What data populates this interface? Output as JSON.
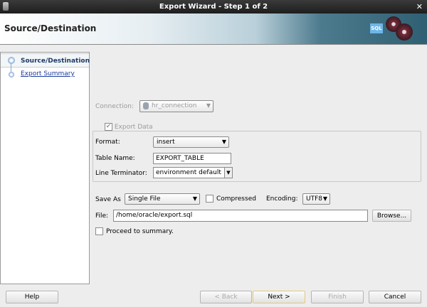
{
  "window": {
    "title": "Export Wizard - Step 1 of 2",
    "close_icon": "close-icon",
    "app_icon": "database-app-icon"
  },
  "header": {
    "title": "Source/Destination",
    "logo_icon": "sql-export-reels-icon"
  },
  "steps": [
    {
      "label": "Source/Destination",
      "selected": true
    },
    {
      "label": "Export Summary",
      "selected": false
    }
  ],
  "form": {
    "connection": {
      "label": "Connection:",
      "value": "hr_connection",
      "icon": "database-icon",
      "enabled": false
    },
    "export_data": {
      "label": "Export Data",
      "checked": true,
      "enabled": false
    },
    "format": {
      "label": "Format:",
      "value": "insert"
    },
    "table_name": {
      "label": "Table Name:",
      "value": "EXPORT_TABLE"
    },
    "line_terminator": {
      "label": "Line Terminator:",
      "value": "environment default"
    },
    "save_as": {
      "label": "Save As",
      "value": "Single File"
    },
    "compressed": {
      "label": "Compressed",
      "checked": false
    },
    "encoding": {
      "label": "Encoding:",
      "value": "UTF8"
    },
    "file": {
      "label": "File:",
      "value": "/home/oracle/export.sql"
    },
    "browse": "Browse...",
    "proceed": {
      "label": "Proceed to summary.",
      "checked": false
    }
  },
  "buttons": {
    "help": "Help",
    "back": "< Back",
    "next": "Next >",
    "finish": "Finish",
    "cancel": "Cancel"
  }
}
